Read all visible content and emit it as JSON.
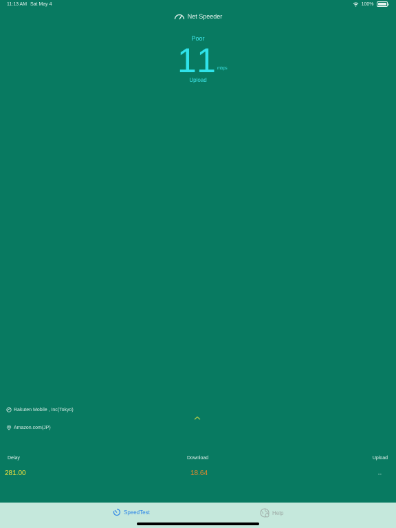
{
  "status_bar": {
    "time": "11:13 AM",
    "date": "Sat May 4",
    "battery": "100%"
  },
  "app": {
    "title": "Net Speeder"
  },
  "speed": {
    "quality": "Poor",
    "value": "11",
    "unit": "mbps",
    "mode": "Upload"
  },
  "connection": {
    "provider": "Rakuten Mobile , Inc(Tokyo)",
    "server": "Amazon.com(JP)"
  },
  "metrics": {
    "delay_label": "Delay",
    "delay_value": "281.00",
    "download_label": "Download",
    "download_value": "18.64",
    "upload_label": "Upload",
    "upload_value": "--"
  },
  "tabs": [
    {
      "label": "SpeedTest",
      "active": true
    },
    {
      "label": "Help",
      "active": false
    }
  ],
  "colors": {
    "background": "#087a61",
    "speed_text": "#2fe3ea",
    "delay": "#f2e23d",
    "download": "#e88a2c",
    "tab_active": "#2f86e6",
    "tab_bar": "#c5e8dc"
  }
}
